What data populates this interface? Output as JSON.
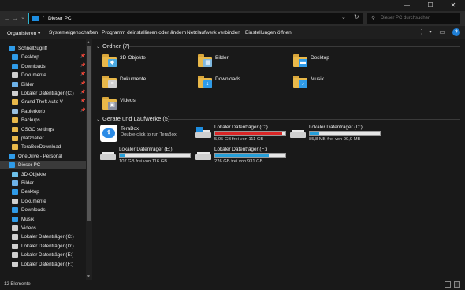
{
  "window": {
    "minimize_glyph": "—",
    "maximize_glyph": "☐",
    "close_glyph": "✕"
  },
  "address": {
    "back_glyph": "←",
    "forward_glyph": "→",
    "down_glyph": "⌄",
    "up_glyph": "↑",
    "separator": "›",
    "path": "Dieser PC",
    "dropdown_glyph": "⌄",
    "refresh_glyph": "↻",
    "search_glyph": "⚲",
    "search_placeholder": "Dieser PC durchsuchen"
  },
  "commands": {
    "organize": "Organisieren",
    "organize_caret": "▾",
    "system_properties": "Systemeigenschaften",
    "uninstall": "Programm deinstallieren oder ändern",
    "map_drive": "Netzlaufwerk verbinden",
    "open_settings": "Einstellungen öffnen",
    "view_glyph": "⋮",
    "view_caret": "▾",
    "preview_glyph": "▭",
    "help_glyph": "?"
  },
  "sidebar": {
    "items": [
      {
        "label": "Schnellzugriff",
        "icon": "star-icon",
        "color": "#2f9be8",
        "pinned": false,
        "indent": 1,
        "selected": false
      },
      {
        "label": "Desktop",
        "icon": "desktop-icon",
        "color": "#2f9be8",
        "pinned": true,
        "indent": 2,
        "selected": false
      },
      {
        "label": "Downloads",
        "icon": "download-icon",
        "color": "#2f9be8",
        "pinned": true,
        "indent": 2,
        "selected": false
      },
      {
        "label": "Dokumente",
        "icon": "document-icon",
        "color": "#cfcfcf",
        "pinned": true,
        "indent": 2,
        "selected": false
      },
      {
        "label": "Bilder",
        "icon": "pictures-icon",
        "color": "#6db2e8",
        "pinned": true,
        "indent": 2,
        "selected": false
      },
      {
        "label": "Lokaler Datenträger (C:)",
        "icon": "drive-icon",
        "color": "#cfcfcf",
        "pinned": true,
        "indent": 2,
        "selected": false
      },
      {
        "label": "Grand Theft Auto V",
        "icon": "folder-icon",
        "color": "#e8b84a",
        "pinned": true,
        "indent": 2,
        "selected": false
      },
      {
        "label": "Papierkorb",
        "icon": "recycle-bin-icon",
        "color": "#9ac0e0",
        "pinned": true,
        "indent": 2,
        "selected": false
      },
      {
        "label": "Backups",
        "icon": "folder-icon",
        "color": "#e8b84a",
        "pinned": false,
        "indent": 2,
        "selected": false
      },
      {
        "label": "CSGO settings",
        "icon": "folder-icon",
        "color": "#e8b84a",
        "pinned": false,
        "indent": 2,
        "selected": false
      },
      {
        "label": "platzhalter",
        "icon": "folder-icon",
        "color": "#e8b84a",
        "pinned": false,
        "indent": 2,
        "selected": false
      },
      {
        "label": "TeraBoxDownload",
        "icon": "folder-icon",
        "color": "#e8b84a",
        "pinned": false,
        "indent": 2,
        "selected": false
      },
      {
        "label": "OneDrive - Personal",
        "icon": "onedrive-icon",
        "color": "#2f9be8",
        "pinned": false,
        "indent": 1,
        "selected": false
      },
      {
        "label": "Dieser PC",
        "icon": "computer-icon",
        "color": "#2f9be8",
        "pinned": false,
        "indent": 1,
        "selected": true
      },
      {
        "label": "3D-Objekte",
        "icon": "3d-objects-icon",
        "color": "#6dc0e8",
        "pinned": false,
        "indent": 2,
        "selected": false
      },
      {
        "label": "Bilder",
        "icon": "pictures-icon",
        "color": "#6db2e8",
        "pinned": false,
        "indent": 2,
        "selected": false
      },
      {
        "label": "Desktop",
        "icon": "desktop-icon",
        "color": "#2f9be8",
        "pinned": false,
        "indent": 2,
        "selected": false
      },
      {
        "label": "Dokumente",
        "icon": "document-icon",
        "color": "#cfcfcf",
        "pinned": false,
        "indent": 2,
        "selected": false
      },
      {
        "label": "Downloads",
        "icon": "download-icon",
        "color": "#2f9be8",
        "pinned": false,
        "indent": 2,
        "selected": false
      },
      {
        "label": "Musik",
        "icon": "music-icon",
        "color": "#2f9be8",
        "pinned": false,
        "indent": 2,
        "selected": false
      },
      {
        "label": "Videos",
        "icon": "video-icon",
        "color": "#cfcfcf",
        "pinned": false,
        "indent": 2,
        "selected": false
      },
      {
        "label": "Lokaler Datenträger (C:)",
        "icon": "drive-icon",
        "color": "#cfcfcf",
        "pinned": false,
        "indent": 2,
        "selected": false
      },
      {
        "label": "Lokaler Datenträger (D:)",
        "icon": "drive-icon",
        "color": "#cfcfcf",
        "pinned": false,
        "indent": 2,
        "selected": false
      },
      {
        "label": "Lokaler Datenträger (E:)",
        "icon": "drive-icon",
        "color": "#cfcfcf",
        "pinned": false,
        "indent": 2,
        "selected": false
      },
      {
        "label": "Lokaler Datenträger (F:)",
        "icon": "drive-icon",
        "color": "#cfcfcf",
        "pinned": false,
        "indent": 2,
        "selected": false
      }
    ]
  },
  "folders_section": {
    "title": "Ordner (7)",
    "chevron": "⌄",
    "items": [
      {
        "label": "3D-Objekte",
        "glyph_color": "#4aa8e0",
        "glyph": "◆"
      },
      {
        "label": "Bilder",
        "glyph_color": "#7fb8e0",
        "glyph": "▦"
      },
      {
        "label": "Desktop",
        "glyph_color": "#2f9be8",
        "glyph": "▬"
      },
      {
        "label": "Dokumente",
        "glyph_color": "#d0d0d0",
        "glyph": "≡"
      },
      {
        "label": "Downloads",
        "glyph_color": "#2f9be8",
        "glyph": "↓"
      },
      {
        "label": "Musik",
        "glyph_color": "#2f9be8",
        "glyph": "♪"
      },
      {
        "label": "Videos",
        "glyph_color": "#8a8fa0",
        "glyph": "▣"
      }
    ]
  },
  "drives_section": {
    "title": "Geräte und Laufwerke (5)",
    "chevron": "⌄",
    "terabox": {
      "name": "TeraBox",
      "subtitle": "Double-click to run TeraBox",
      "glyph": "⇧"
    },
    "drives": [
      {
        "name": "Lokaler Datenträger (C:)",
        "free": "5,05 GB frei von 111 GB",
        "used_fraction": 0.955,
        "bar_color": "#da2626",
        "system": true
      },
      {
        "name": "Lokaler Datenträger (D:)",
        "free": "85,8 MB frei von 99,9 MB",
        "used_fraction": 0.14,
        "bar_color": "#26a0da",
        "system": false
      },
      {
        "name": "Lokaler Datenträger (E:)",
        "free": "107 GB frei von 116 GB",
        "used_fraction": 0.08,
        "bar_color": "#26a0da",
        "system": false
      },
      {
        "name": "Lokaler Datenträger (F:)",
        "free": "226 GB frei von 931 GB",
        "used_fraction": 0.76,
        "bar_color": "#26a0da",
        "system": false
      }
    ]
  },
  "sidebar_scroll": {
    "up_glyph": "▲",
    "down_glyph": "▼"
  },
  "status": {
    "count": "12 Elemente"
  },
  "colors": {
    "accent": "#2fb4ce",
    "selection": "#3a3a3a",
    "background": "#191919"
  }
}
